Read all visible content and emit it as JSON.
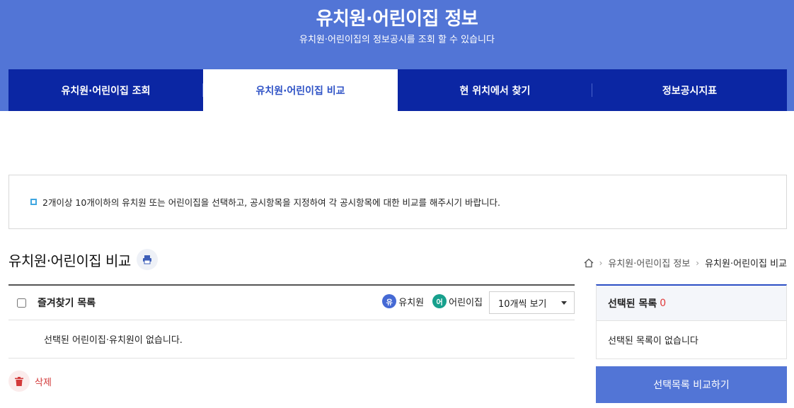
{
  "header": {
    "title": "유치원·어린이집 정보",
    "subtitle": "유치원·어린이집의 정보공시를 조회 할 수 있습니다"
  },
  "tabs": [
    {
      "label": "유치원·어린이집 조회",
      "active": false
    },
    {
      "label": "유치원·어린이집 비교",
      "active": true
    },
    {
      "label": "현 위치에서 찾기",
      "active": false
    },
    {
      "label": "정보공시지표",
      "active": false
    }
  ],
  "notice": {
    "text": "2개이상 10개이하의 유치원 또는 어린이집을 선택하고, 공시항목을 지정하여 각 공시항목에 대한 비교를 해주시기 바랍니다."
  },
  "page_title": "유치원·어린이집 비교",
  "icons": {
    "print": "print-icon",
    "home": "home-icon",
    "trash": "trash-icon"
  },
  "breadcrumb": {
    "items": [
      "유치원·어린이집 정보",
      "유치원·어린이집 비교"
    ]
  },
  "favorites": {
    "title": "즐겨찾기 목록",
    "legend": [
      {
        "badge": "유",
        "label": "유치원",
        "color": "#4569d4"
      },
      {
        "badge": "어",
        "label": "어린이집",
        "color": "#17a08d"
      }
    ],
    "page_size_selected": "10개씩 보기",
    "empty_message": "선택된 어린이집·유치원이 없습니다."
  },
  "delete_label": "삭제",
  "selected": {
    "title": "선택된 목록",
    "count": "0",
    "empty_message": "선택된 목록이 없습니다",
    "compare_button": "선택목록 비교하기"
  },
  "colors": {
    "hero_bg": "#5275d6",
    "tab_bar": "#0b26a3",
    "active_tab_text": "#2f53c6",
    "delete_red": "#d33a3a"
  }
}
